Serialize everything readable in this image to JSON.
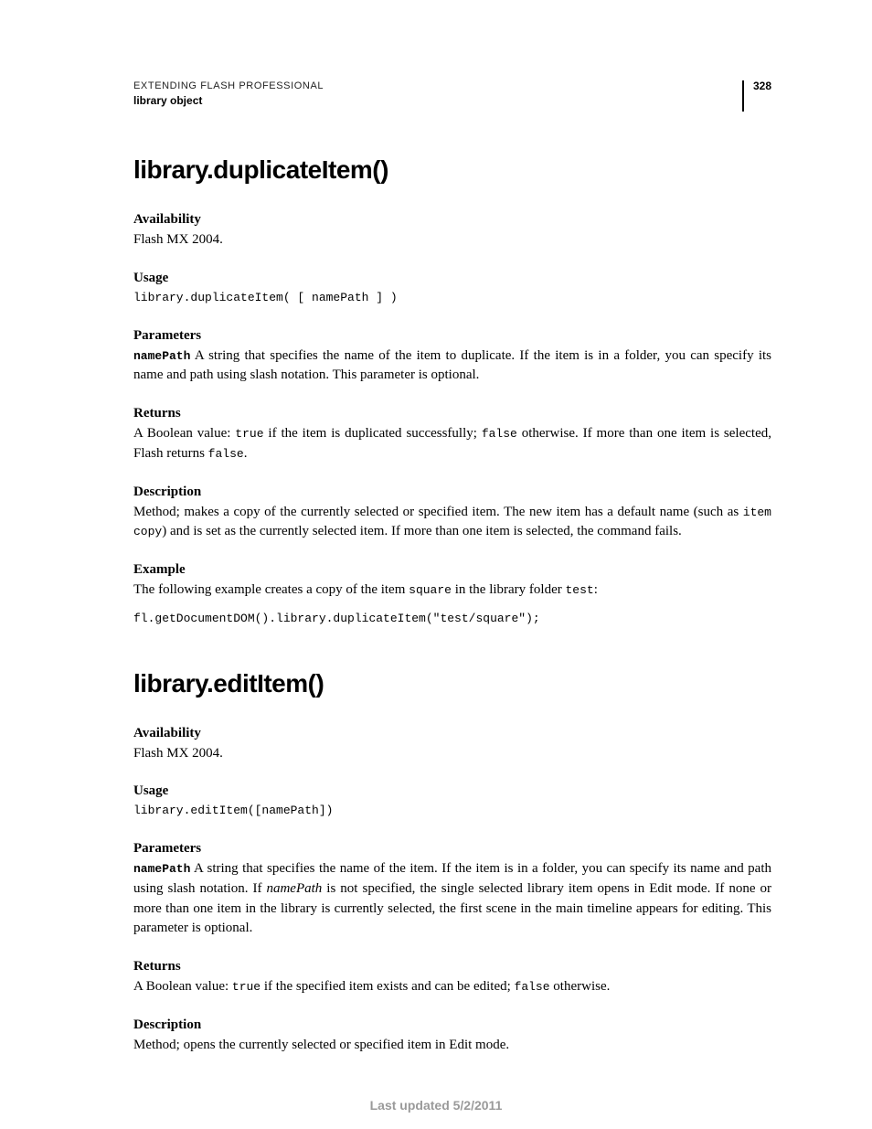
{
  "header": {
    "running_head": "EXTENDING FLASH PROFESSIONAL",
    "chapter": "library object",
    "page_number": "328"
  },
  "sections": [
    {
      "title": "library.duplicateItem()",
      "availability_label": "Availability",
      "availability_body": "Flash MX 2004.",
      "usage_label": "Usage",
      "usage_code": "library.duplicateItem( [ namePath ] )",
      "parameters_label": "Parameters",
      "param_name": "namePath",
      "param_body_1": "  A string that specifies the name of the item to duplicate. If the item is in a folder, you can specify its name and path using slash notation. This parameter is optional.",
      "returns_label": "Returns",
      "returns_pre": "A Boolean value: ",
      "returns_code1": "true",
      "returns_mid": " if the item is duplicated successfully; ",
      "returns_code2": "false",
      "returns_post": " otherwise. If more than one item is selected, Flash returns ",
      "returns_code3": "false",
      "returns_end": ".",
      "description_label": "Description",
      "description_pre": "Method; makes a copy of the currently selected or specified item. The new item has a default name (such as ",
      "description_code": "item copy",
      "description_post": ") and is set as the currently selected item. If more than one item is selected, the command fails.",
      "example_label": "Example",
      "example_pre": "The following example creates a copy of the item ",
      "example_code1": "square",
      "example_mid": " in the library folder ",
      "example_code2": "test",
      "example_end": ":",
      "example_block": "fl.getDocumentDOM().library.duplicateItem(\"test/square\");"
    },
    {
      "title": "library.editItem()",
      "availability_label": "Availability",
      "availability_body": "Flash MX 2004.",
      "usage_label": "Usage",
      "usage_code": "library.editItem([namePath])",
      "parameters_label": "Parameters",
      "param_name": "namePath",
      "param_body_pre": "  A string that specifies the name of the item. If the item is in a folder, you can specify its name and path using slash notation. If ",
      "param_body_italic": "namePath",
      "param_body_post": " is not specified, the single selected library item opens in Edit mode. If none or more than one item in the library is currently selected, the first scene in the main timeline appears for editing. This parameter is optional.",
      "returns_label": "Returns",
      "returns_pre": "A Boolean value: ",
      "returns_code1": "true",
      "returns_mid": " if the specified item exists and can be edited; ",
      "returns_code2": "false",
      "returns_post": " otherwise.",
      "description_label": "Description",
      "description_body": "Method; opens the currently selected or specified item in Edit mode."
    }
  ],
  "footer": "Last updated 5/2/2011"
}
